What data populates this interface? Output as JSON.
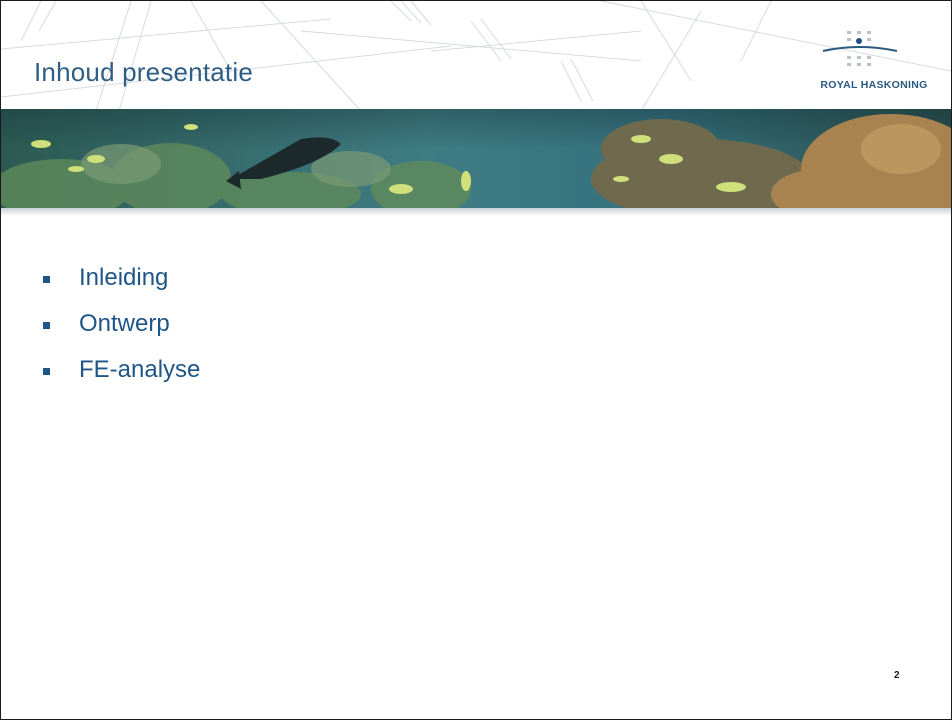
{
  "slide": {
    "title": "Inhoud presentatie",
    "logo_text": "ROYAL HASKONING",
    "bullets": [
      {
        "label": "Inleiding"
      },
      {
        "label": "Ontwerp"
      },
      {
        "label": "FE-analyse"
      }
    ],
    "page_number": "2"
  },
  "colors": {
    "title": "#2e5e86",
    "bullet_text": "#1f5688",
    "logo": "#2b5a80"
  }
}
